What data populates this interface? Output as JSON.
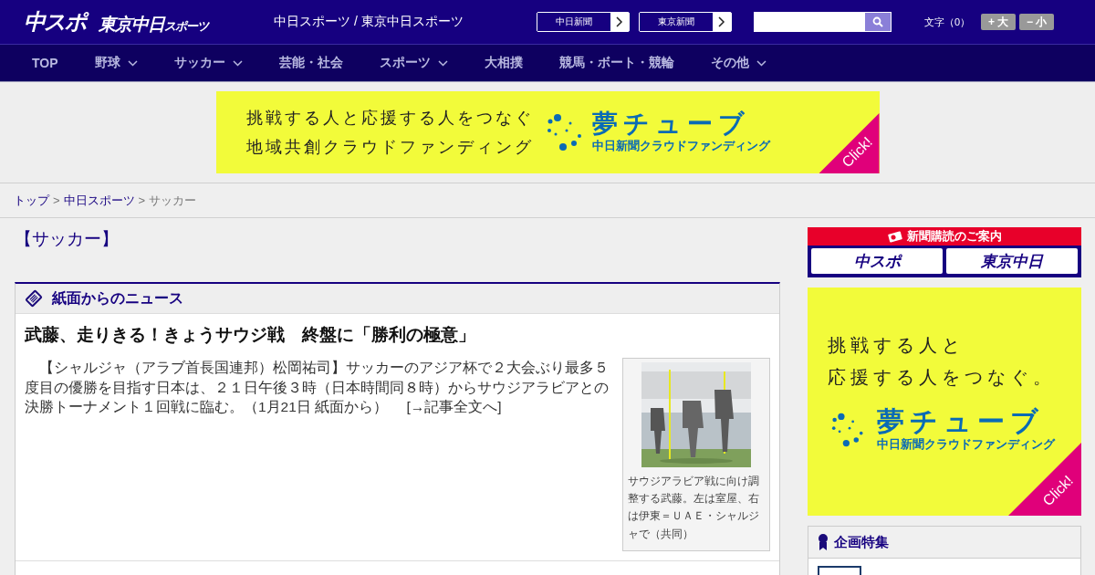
{
  "header": {
    "logo_main": "中スポ",
    "logo_sub": "東京中日",
    "logo_sub_small": "スポーツ",
    "site_title": "中日スポーツ / 東京中日スポーツ",
    "links": [
      {
        "label": "中日新聞"
      },
      {
        "label": "東京新聞"
      }
    ],
    "font_size": {
      "label": "文字（0）",
      "buttons": [
        "+ 大",
        "− 小"
      ]
    }
  },
  "nav": [
    {
      "label": "TOP",
      "has_menu": false
    },
    {
      "label": "野球",
      "has_menu": true
    },
    {
      "label": "サッカー",
      "has_menu": true
    },
    {
      "label": "芸能・社会",
      "has_menu": false
    },
    {
      "label": "スポーツ",
      "has_menu": true
    },
    {
      "label": "大相撲",
      "has_menu": false
    },
    {
      "label": "競馬・ボート・競輪",
      "has_menu": false
    },
    {
      "label": "その他",
      "has_menu": true
    }
  ],
  "banner": {
    "lines": [
      "挑戦する人と応援する人をつなぐ",
      "地域共創クラウドファンディング"
    ],
    "brand": "夢チューブ",
    "brand_sub": "中日新聞クラウドファンディング",
    "corner": "Click!"
  },
  "breadcrumb": {
    "separator": ">",
    "items": [
      {
        "label": "トップ",
        "link": true
      },
      {
        "label": "中日スポーツ",
        "link": true
      },
      {
        "label": "サッカー",
        "link": false
      }
    ]
  },
  "page_heading": "【サッカー】",
  "news": {
    "title": "紙面からのニュース",
    "headline": "武藤、走りきる！きょうサウジ戦　終盤に「勝利の極意」",
    "body": "【シャルジャ（アラブ首長国連邦）松岡祐司】サッカーのアジア杯で２大会ぶり最多５度目の優勝を目指す日本は、２１日午後３時（日本時間同８時）からサウジアラビアとの決勝トーナメント１回戦に臨む。（1月21日 紙面から）",
    "more_link": "[→記事全文へ]",
    "photo_caption": "サウジアラビア戦に向け調整する武藤。左は室屋、右は伊東＝ＵＡＥ・シャルジャで（共同）"
  },
  "sidebar": {
    "subscription": {
      "title": "新聞購読のご案内",
      "logos": [
        "中スポ",
        "東京中日"
      ]
    },
    "ad": {
      "lines": [
        "挑戦する人と",
        "応援する人をつなぐ。"
      ],
      "brand": "夢チューブ",
      "brand_sub": "中日新聞クラウドファンディング",
      "corner": "Click!"
    },
    "feature_title": "企画特集"
  }
}
